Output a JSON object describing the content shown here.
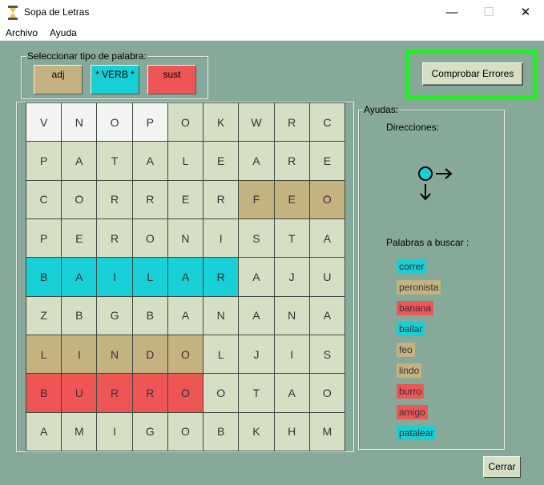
{
  "window": {
    "title": "Sopa de Letras",
    "min": "—",
    "max": "☐",
    "close": "✕"
  },
  "menu": [
    "Archivo",
    "Ayuda"
  ],
  "type_selector": {
    "legend": "Seleccionar tipo de palabra:",
    "buttons": [
      {
        "label": "adj",
        "color": "#c4b280"
      },
      {
        "label": "* VERB *",
        "color": "#17cfd6"
      },
      {
        "label": "sust",
        "color": "#ee5656"
      }
    ]
  },
  "check_button": "Comprobar Errores",
  "grid": {
    "rows": [
      [
        "V",
        "N",
        "O",
        "P",
        "O",
        "K",
        "W",
        "R",
        "C"
      ],
      [
        "P",
        "A",
        "T",
        "A",
        "L",
        "E",
        "A",
        "R",
        "E"
      ],
      [
        "C",
        "O",
        "R",
        "R",
        "E",
        "R",
        "F",
        "E",
        "O"
      ],
      [
        "P",
        "E",
        "R",
        "O",
        "N",
        "I",
        "S",
        "T",
        "A"
      ],
      [
        "B",
        "A",
        "I",
        "L",
        "A",
        "R",
        "A",
        "J",
        "U"
      ],
      [
        "Z",
        "B",
        "G",
        "B",
        "A",
        "N",
        "A",
        "N",
        "A"
      ],
      [
        "L",
        "I",
        "N",
        "D",
        "O",
        "L",
        "J",
        "I",
        "S"
      ],
      [
        "B",
        "U",
        "R",
        "R",
        "O",
        "O",
        "T",
        "A",
        "O"
      ],
      [
        "A",
        "M",
        "I",
        "G",
        "O",
        "B",
        "K",
        "H",
        "M"
      ]
    ],
    "highlights": [
      [
        "white",
        "white",
        "white",
        "white",
        "",
        "",
        "",
        "",
        ""
      ],
      [
        "",
        "",
        "",
        "",
        "",
        "",
        "",
        "",
        ""
      ],
      [
        "",
        "",
        "",
        "",
        "",
        "",
        "adj",
        "adj",
        "adj"
      ],
      [
        "",
        "",
        "",
        "",
        "",
        "",
        "",
        "",
        ""
      ],
      [
        "verb",
        "verb",
        "verb",
        "verb",
        "verb",
        "verb",
        "",
        "",
        ""
      ],
      [
        "",
        "",
        "",
        "",
        "",
        "",
        "",
        "",
        ""
      ],
      [
        "adj",
        "adj",
        "adj",
        "adj",
        "adj",
        "",
        "",
        "",
        ""
      ],
      [
        "sust",
        "sust",
        "sust",
        "sust",
        "sust",
        "",
        "",
        "",
        ""
      ],
      [
        "",
        "",
        "",
        "",
        "",
        "",
        "",
        "",
        ""
      ]
    ]
  },
  "help": {
    "legend": "Ayudas:",
    "directions_label": "Direcciones:",
    "direction_icon": "right-down-arrows-icon",
    "words_label": "Palabras a buscar :",
    "words": [
      {
        "text": "correr",
        "type": "verb"
      },
      {
        "text": "peronista",
        "type": "adj"
      },
      {
        "text": "banana",
        "type": "sust"
      },
      {
        "text": "bailar",
        "type": "verb"
      },
      {
        "text": "feo",
        "type": "adj"
      },
      {
        "text": "lindo",
        "type": "adj"
      },
      {
        "text": "burro",
        "type": "sust"
      },
      {
        "text": "amigo",
        "type": "sust"
      },
      {
        "text": "patalear",
        "type": "verb"
      }
    ]
  },
  "close_button": "Cerrar",
  "colors": {
    "background": "#86a99a",
    "cell": "#d6dfc4",
    "adj": "#c4b280",
    "verb": "#17cfd6",
    "sust": "#ee5656",
    "highlight_border": "#22ee22"
  }
}
